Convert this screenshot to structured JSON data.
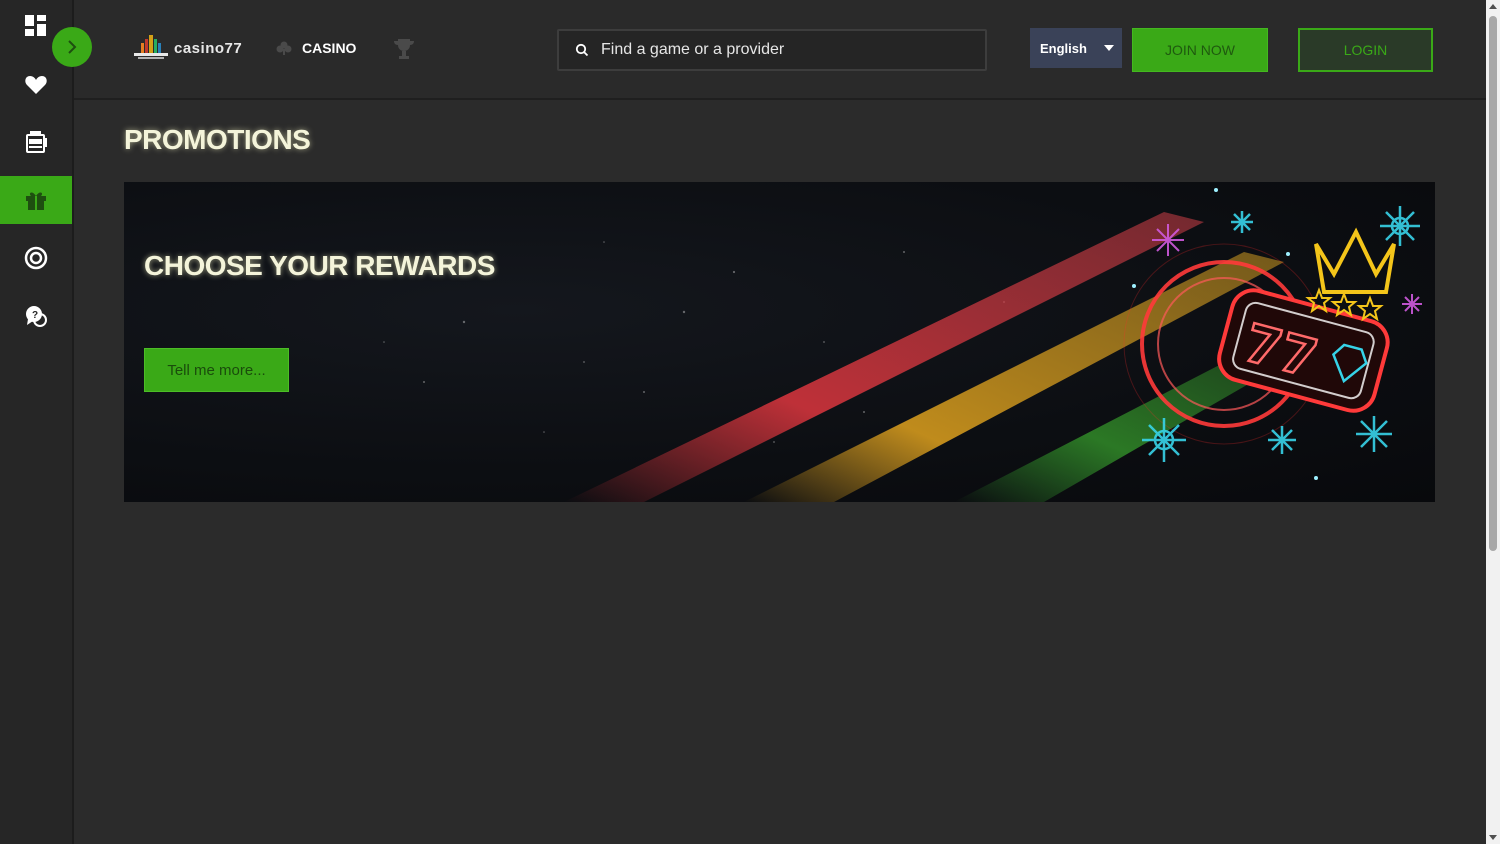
{
  "brand": {
    "name": "casino77",
    "accent": "#3aa917",
    "title_color": "#f4f4da"
  },
  "sidebar": {
    "items": [
      {
        "icon": "dashboard-icon",
        "active": false
      },
      {
        "icon": "heart-icon",
        "active": false
      },
      {
        "icon": "slot-machine-icon",
        "active": false
      },
      {
        "icon": "gift-icon",
        "active": true
      },
      {
        "icon": "live-chip-icon",
        "active": false
      },
      {
        "icon": "support-chat-icon",
        "active": false
      }
    ],
    "expand_icon": "chevron-right-icon"
  },
  "header": {
    "logo_text": "casino77",
    "nav": {
      "casino_label": "CASINO",
      "casino_icon": "club-icon",
      "tournaments_icon": "trophy-icon"
    },
    "search": {
      "placeholder": "Find a game or a provider",
      "value": ""
    },
    "language": {
      "selected": "English"
    },
    "join_label": "JOIN NOW",
    "login_label": "LOGIN"
  },
  "main": {
    "title": "PROMOTIONS",
    "promotions": [
      {
        "title": "CHOOSE YOUR REWARDS",
        "cta": "Tell me more..."
      }
    ]
  }
}
